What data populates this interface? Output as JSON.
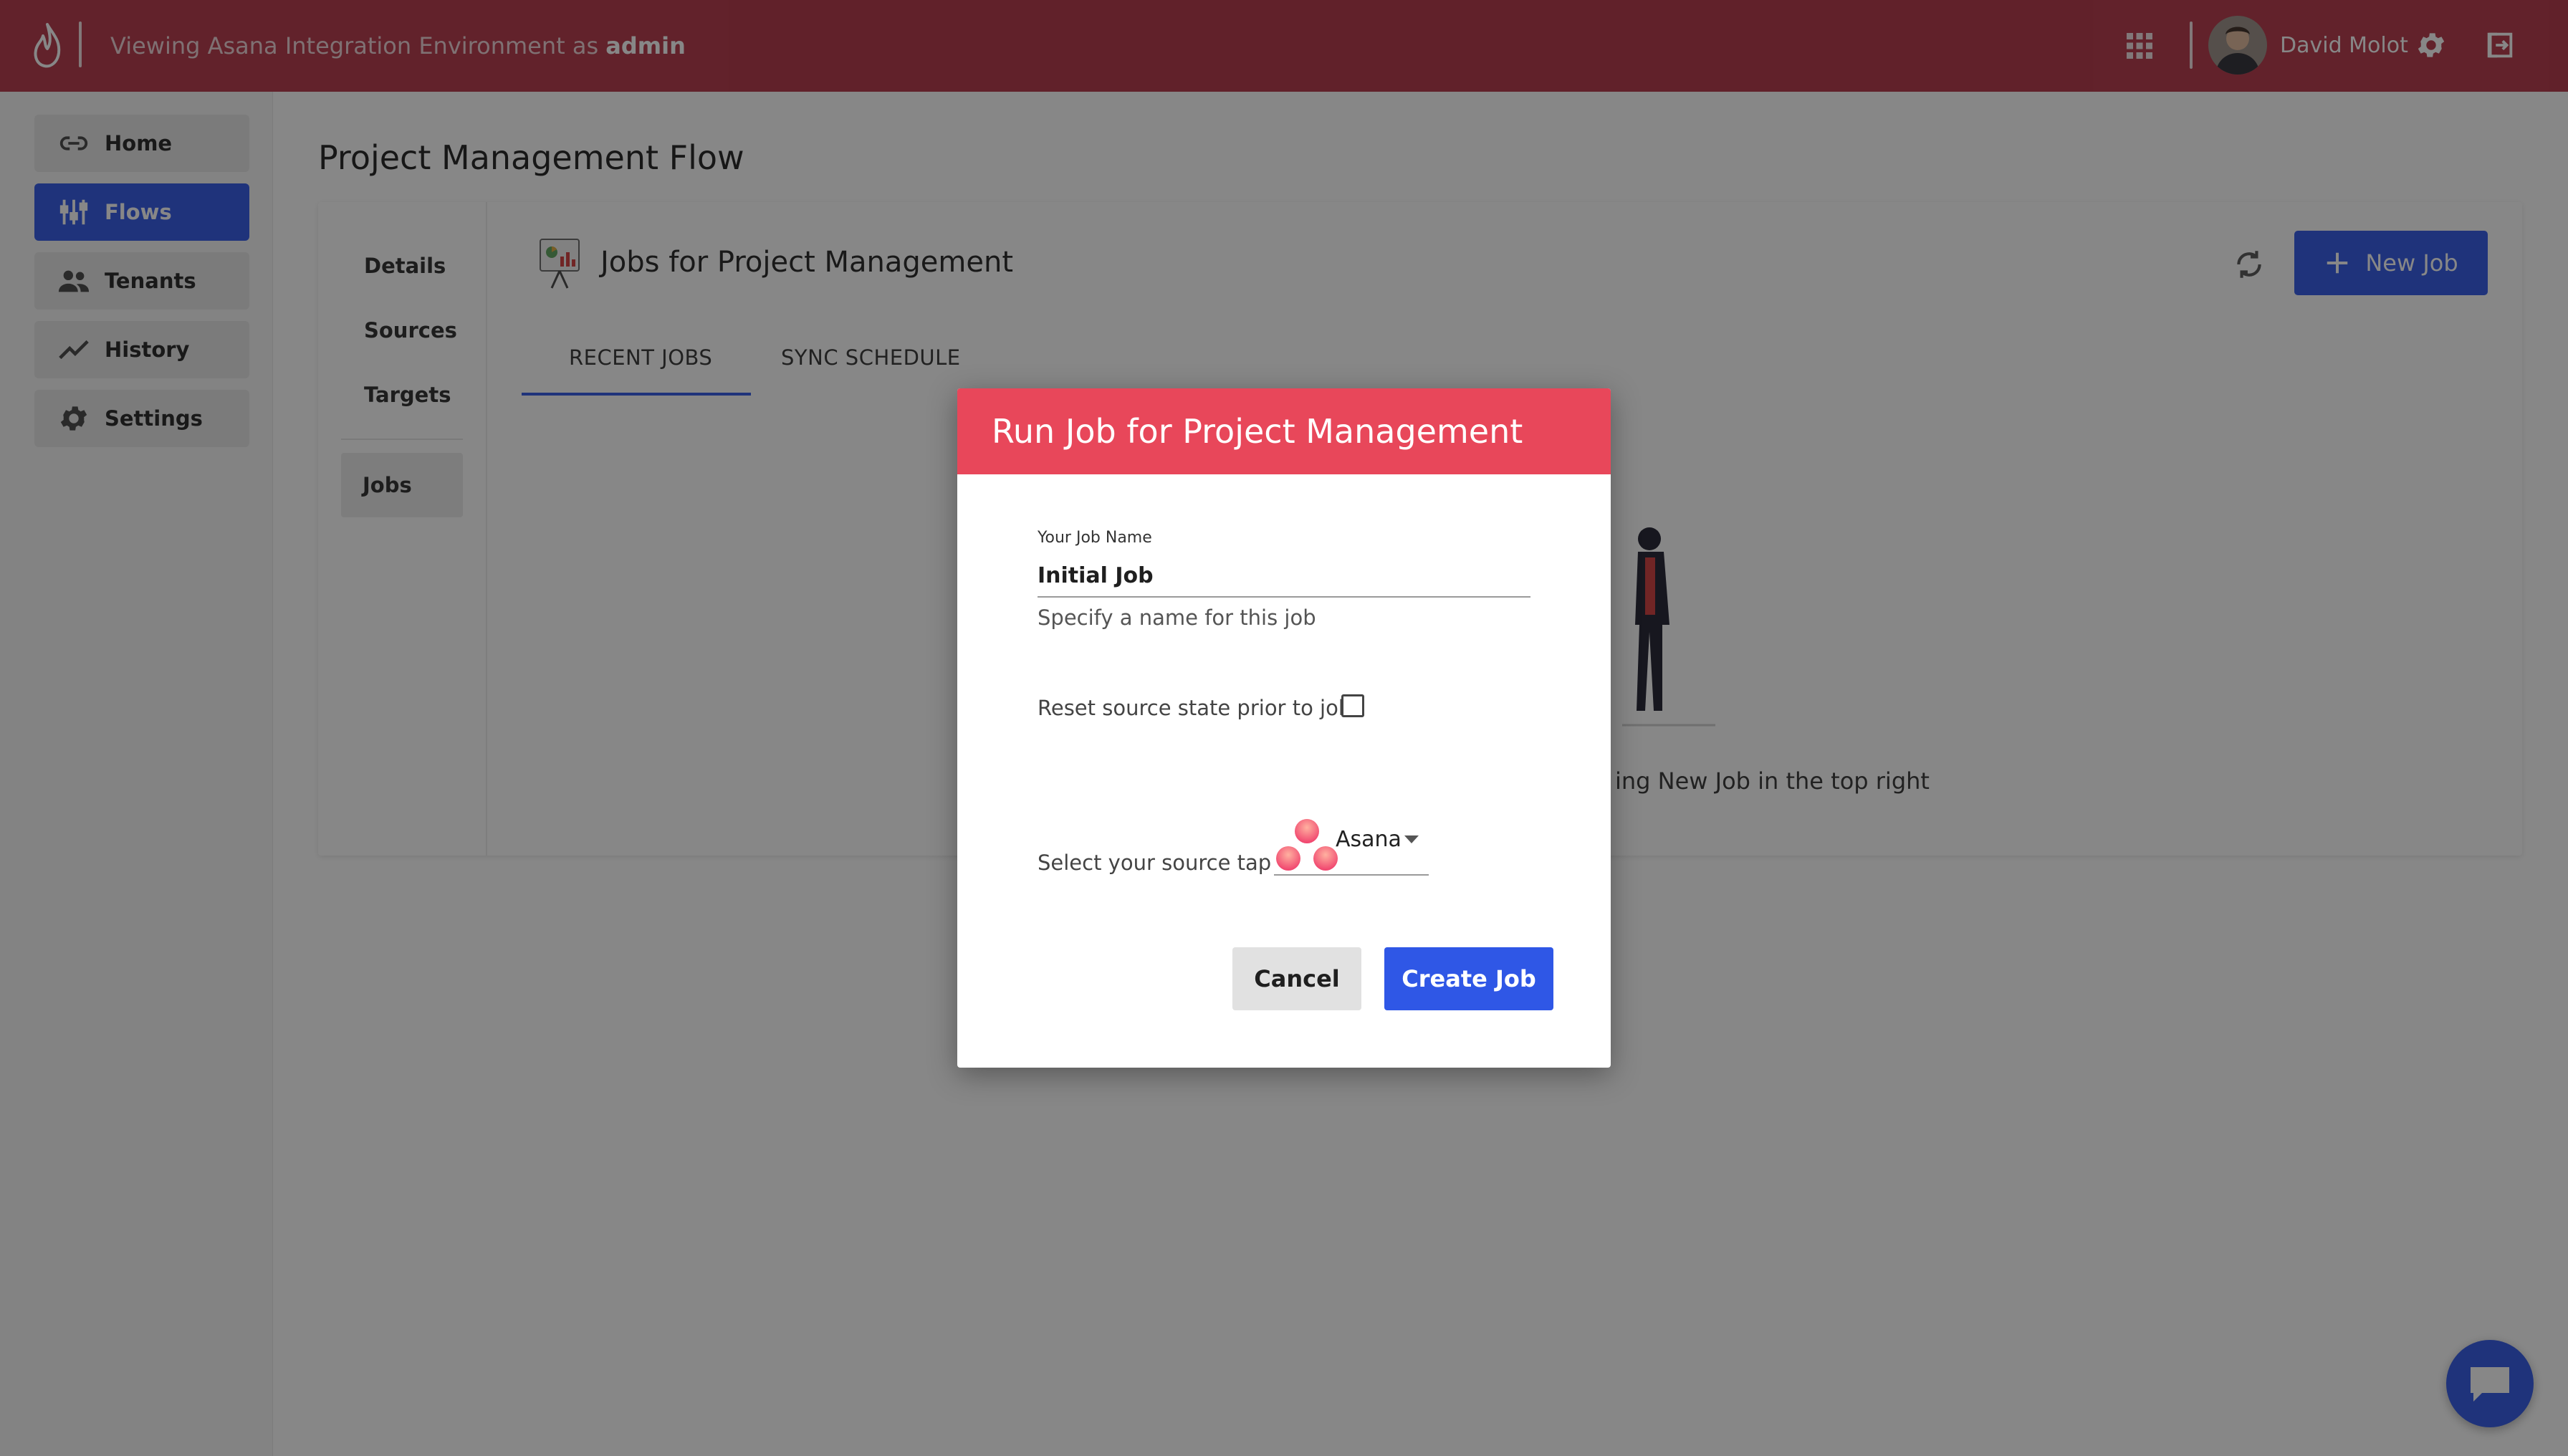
{
  "header": {
    "env_prefix": "Viewing Asana Integration Environment as ",
    "env_role": "admin",
    "user_name": "David Molot"
  },
  "sidebar": {
    "items": [
      {
        "label": "Home",
        "icon": "link-icon",
        "active": false
      },
      {
        "label": "Flows",
        "icon": "flows-icon",
        "active": true
      },
      {
        "label": "Tenants",
        "icon": "people-icon",
        "active": false
      },
      {
        "label": "History",
        "icon": "trend-icon",
        "active": false
      },
      {
        "label": "Settings",
        "icon": "gear-icon",
        "active": false
      }
    ]
  },
  "page": {
    "title": "Project Management Flow"
  },
  "flow_nav": {
    "details": "Details",
    "sources": "Sources",
    "targets": "Targets",
    "jobs": "Jobs"
  },
  "jobs_panel": {
    "title": "Jobs for Project Management",
    "new_job_label": "New Job",
    "tabs": [
      {
        "label": "RECENT JOBS",
        "active": true
      },
      {
        "label": "SYNC SCHEDULE",
        "active": false
      }
    ],
    "empty_hint_visible": "ing New Job in the top right"
  },
  "modal": {
    "title": "Run Job for Project Management",
    "job_name_label": "Your Job Name",
    "job_name_value": "Initial Job",
    "job_name_help": "Specify a name for this job",
    "reset_label": "Reset source state prior to job",
    "reset_checked": false,
    "source_label": "Select your source tap",
    "source_value": "Asana",
    "cancel_label": "Cancel",
    "create_label": "Create Job"
  },
  "colors": {
    "header": "#b43446",
    "modal_header": "#e8475a",
    "primary": "#2f57e6"
  }
}
